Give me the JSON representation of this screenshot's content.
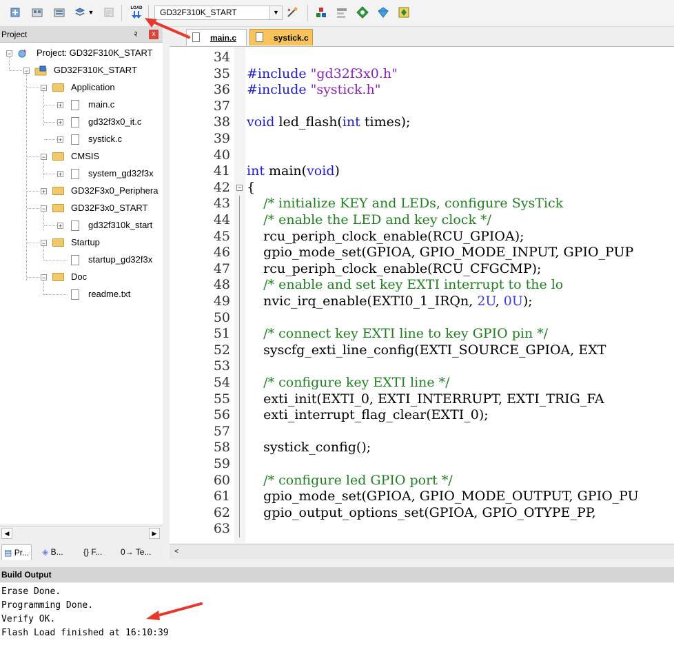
{
  "toolbar": {
    "target_name": "GD32F310K_START",
    "load_label": "LOAD"
  },
  "project_panel": {
    "title": "Project",
    "pin": "२",
    "close": "x",
    "tree": [
      {
        "label": "Project: GD32F310K_START",
        "expander": "−"
      },
      {
        "label": "GD32F310K_START",
        "expander": "−"
      },
      {
        "label": "Application",
        "expander": "−"
      },
      {
        "label": "main.c",
        "expander": "+"
      },
      {
        "label": "gd32f3x0_it.c",
        "expander": "+"
      },
      {
        "label": "systick.c",
        "expander": "+"
      },
      {
        "label": "CMSIS",
        "expander": "−"
      },
      {
        "label": "system_gd32f3x",
        "expander": "+"
      },
      {
        "label": "GD32F3x0_Periphera",
        "expander": "+"
      },
      {
        "label": "GD32F3x0_START",
        "expander": "−"
      },
      {
        "label": "gd32f310k_start",
        "expander": "+"
      },
      {
        "label": "Startup",
        "expander": "−"
      },
      {
        "label": "startup_gd32f3x",
        "expander": ""
      },
      {
        "label": "Doc",
        "expander": "−"
      },
      {
        "label": "readme.txt",
        "expander": ""
      }
    ],
    "tabs": [
      "Pr...",
      "B...",
      "{} F...",
      "0→ Te..."
    ]
  },
  "editor": {
    "tabs": [
      "main.c",
      "systick.c"
    ],
    "lines": [
      {
        "n": "34",
        "html": ""
      },
      {
        "n": "35",
        "html": "<span class=\"pp\">#include</span> <span class=\"str\">\"gd32f3x0.h\"</span>"
      },
      {
        "n": "36",
        "html": "<span class=\"pp\">#include</span> <span class=\"str\">\"systick.h\"</span>"
      },
      {
        "n": "37",
        "html": ""
      },
      {
        "n": "38",
        "html": "<span class=\"kw\">void</span> led_flash(<span class=\"kw\">int</span> times);"
      },
      {
        "n": "39",
        "html": ""
      },
      {
        "n": "40",
        "html": ""
      },
      {
        "n": "41",
        "html": "<span class=\"kw\">int</span> main(<span class=\"kw\">void</span>)"
      },
      {
        "n": "42",
        "html": "{"
      },
      {
        "n": "43",
        "html": "    <span class=\"cm\">/* initialize KEY and LEDs, configure SysTick</span>"
      },
      {
        "n": "44",
        "html": "    <span class=\"cm\">/* enable the LED and key clock */</span>"
      },
      {
        "n": "45",
        "html": "    rcu_periph_clock_enable(RCU_GPIOA);"
      },
      {
        "n": "46",
        "html": "    gpio_mode_set(GPIOA, GPIO_MODE_INPUT, GPIO_PUP"
      },
      {
        "n": "47",
        "html": "    rcu_periph_clock_enable(RCU_CFGCMP);"
      },
      {
        "n": "48",
        "html": "    <span class=\"cm\">/* enable and set key EXTI interrupt to the lo</span>"
      },
      {
        "n": "49",
        "html": "    nvic_irq_enable(EXTI0_1_IRQn, <span class=\"numlit\">2U</span>, <span class=\"numlit\">0U</span>);"
      },
      {
        "n": "50",
        "html": ""
      },
      {
        "n": "51",
        "html": "    <span class=\"cm\">/* connect key EXTI line to key GPIO pin */</span>"
      },
      {
        "n": "52",
        "html": "    syscfg_exti_line_config(EXTI_SOURCE_GPIOA, EXT"
      },
      {
        "n": "53",
        "html": ""
      },
      {
        "n": "54",
        "html": "    <span class=\"cm\">/* configure key EXTI line */</span>"
      },
      {
        "n": "55",
        "html": "    exti_init(EXTI_0, EXTI_INTERRUPT, EXTI_TRIG_FA"
      },
      {
        "n": "56",
        "html": "    exti_interrupt_flag_clear(EXTI_0);"
      },
      {
        "n": "57",
        "html": ""
      },
      {
        "n": "58",
        "html": "    systick_config();"
      },
      {
        "n": "59",
        "html": ""
      },
      {
        "n": "60",
        "html": "    <span class=\"cm\">/* configure led GPIO port */</span>"
      },
      {
        "n": "61",
        "html": "    gpio_mode_set(GPIOA, GPIO_MODE_OUTPUT, GPIO_PU"
      },
      {
        "n": "62",
        "html": "    gpio_output_options_set(GPIOA, GPIO_OTYPE_PP,"
      },
      {
        "n": "63",
        "html": ""
      }
    ]
  },
  "build_output": {
    "title": "Build Output",
    "lines": [
      "Erase Done.",
      "Programming Done.",
      "Verify OK.",
      "Flash Load finished at 16:10:39"
    ]
  },
  "colors": {
    "keyword": "#1e1ecc",
    "string": "#8b23b8",
    "comment": "#208020",
    "active_tab": "#f7c35a",
    "annotation_arrow": "#e8382b"
  }
}
